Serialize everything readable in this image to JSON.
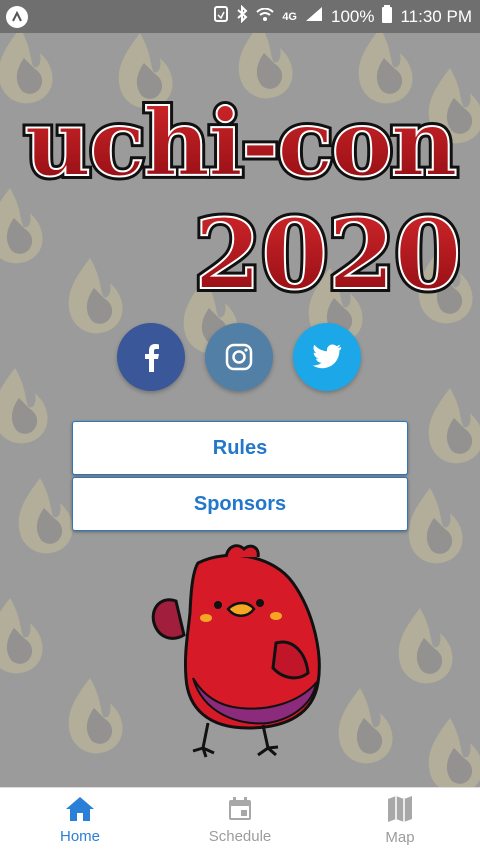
{
  "status_bar": {
    "network_label": "4G",
    "battery_text": "100%",
    "time": "11:30 PM"
  },
  "logo": {
    "line1": "uchi-con",
    "line2": "2020",
    "fill_color": "#b4121b",
    "outline_color": "#111111"
  },
  "social": [
    {
      "name": "facebook",
      "icon": "facebook-icon",
      "color": "#3a579a"
    },
    {
      "name": "instagram",
      "icon": "instagram-icon",
      "color": "#517fa6"
    },
    {
      "name": "twitter",
      "icon": "twitter-icon",
      "color": "#1ca7e8"
    }
  ],
  "menu": {
    "rules_label": "Rules",
    "sponsors_label": "Sponsors"
  },
  "tabbar": {
    "tabs": [
      {
        "label": "Home",
        "icon": "home-icon",
        "active": true
      },
      {
        "label": "Schedule",
        "icon": "calendar-icon",
        "active": false
      },
      {
        "label": "Map",
        "icon": "map-icon",
        "active": false
      }
    ]
  },
  "colors": {
    "accent": "#2a7fd6",
    "button_text": "#2277cc",
    "bg_gray": "#9b9b9b"
  }
}
